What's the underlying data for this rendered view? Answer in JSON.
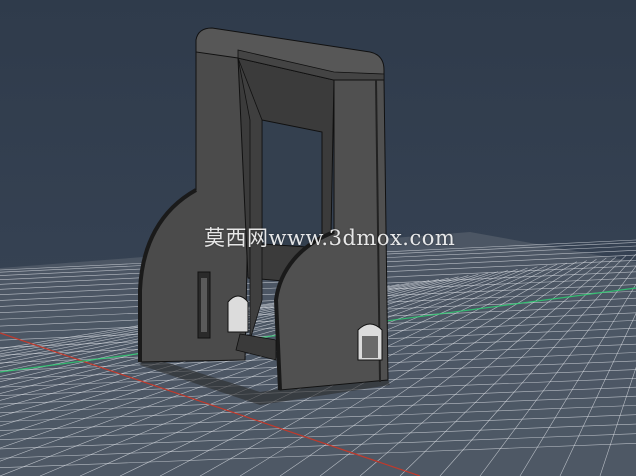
{
  "viewport": {
    "background": "#34404f",
    "grid_color": "#e6e9ee",
    "x_axis_color": "#c0392b",
    "y_axis_color": "#2ecc71",
    "model_color": "#4a4a4a",
    "edge_color": "#111111"
  },
  "watermark": {
    "text": "莫西网www.3dmox.com"
  }
}
